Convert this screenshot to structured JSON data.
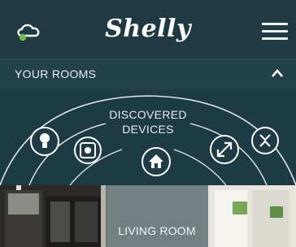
{
  "header": {
    "logo_text": "Shelly",
    "cloud_icon": "cloud-connected-icon",
    "menu_icon": "hamburger-menu-icon",
    "status_dot_color": "#6cc04a"
  },
  "rooms_bar": {
    "label": "YOUR ROOMS",
    "toggle_icon": "chevron-up-icon"
  },
  "discovered": {
    "label_line1": "DISCOVERED",
    "label_line2": "DEVICES",
    "icons": [
      "bulb-icon",
      "plug-icon",
      "home-icon",
      "expand-arrows-icon",
      "roller-shutter-icon"
    ]
  },
  "room_card": {
    "label": "LIVING ROOM"
  }
}
